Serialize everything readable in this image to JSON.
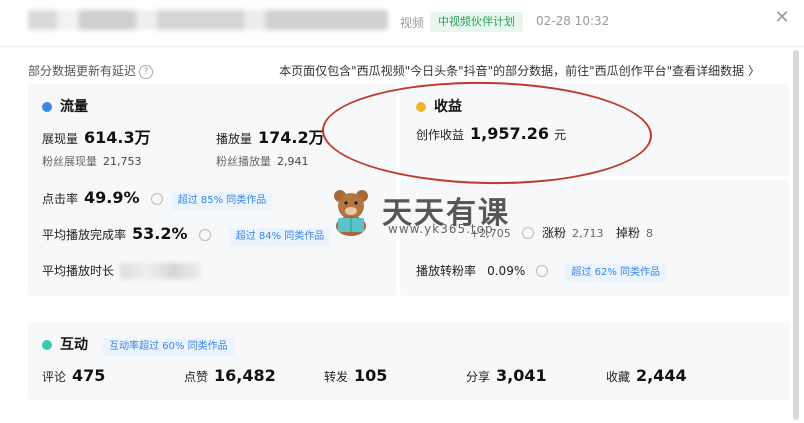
{
  "header": {
    "category": "视频",
    "program_badge": "中视频伙伴计划",
    "datetime": "02-28 10:32",
    "close_icon": "close-icon"
  },
  "notice": {
    "delay_text": "部分数据更新有延迟",
    "scope_text": "本页面仅包含\"西瓜视频\"今日头条\"抖音\"的部分数据，前往\"西瓜创作平台\"查看详细数据 〉"
  },
  "traffic": {
    "title": "流量",
    "impressions_label": "展现量",
    "impressions_value": "614.3万",
    "plays_label": "播放量",
    "plays_value": "174.2万",
    "fan_impressions_label": "粉丝展现量",
    "fan_impressions_value": "21,753",
    "fan_plays_label": "粉丝播放量",
    "fan_plays_value": "2,941",
    "ctr_label": "点击率",
    "ctr_value": "49.9%",
    "ctr_tag": "超过 85% 同类作品",
    "completion_label": "平均播放完成率",
    "completion_value": "53.2%",
    "completion_tag": "超过 84% 同类作品",
    "avg_duration_label": "平均播放时长",
    "accent_color": "#3a86e8"
  },
  "income": {
    "title": "收益",
    "creation_income_label": "创作收益",
    "creation_income_value": "1,957.26",
    "creation_income_unit": "元",
    "accent_color": "#f0b429"
  },
  "fans": {
    "net_value": "+2,705",
    "gain_label": "涨粉",
    "gain_value": "2,713",
    "loss_label": "掉粉",
    "loss_value": "8",
    "conversion_label": "播放转粉率",
    "conversion_value": "0.09%",
    "conversion_tag": "超过 62% 同类作品"
  },
  "interaction": {
    "title": "互动",
    "tag": "互动率超过 60% 同类作品",
    "comments_label": "评论",
    "comments_value": "475",
    "likes_label": "点赞",
    "likes_value": "16,482",
    "reposts_label": "转发",
    "reposts_value": "105",
    "shares_label": "分享",
    "shares_value": "3,041",
    "favorites_label": "收藏",
    "favorites_value": "2,444",
    "accent_color": "#3cc8b4"
  },
  "watermark": {
    "title": "天天有课",
    "url": "www.yk365.top"
  }
}
